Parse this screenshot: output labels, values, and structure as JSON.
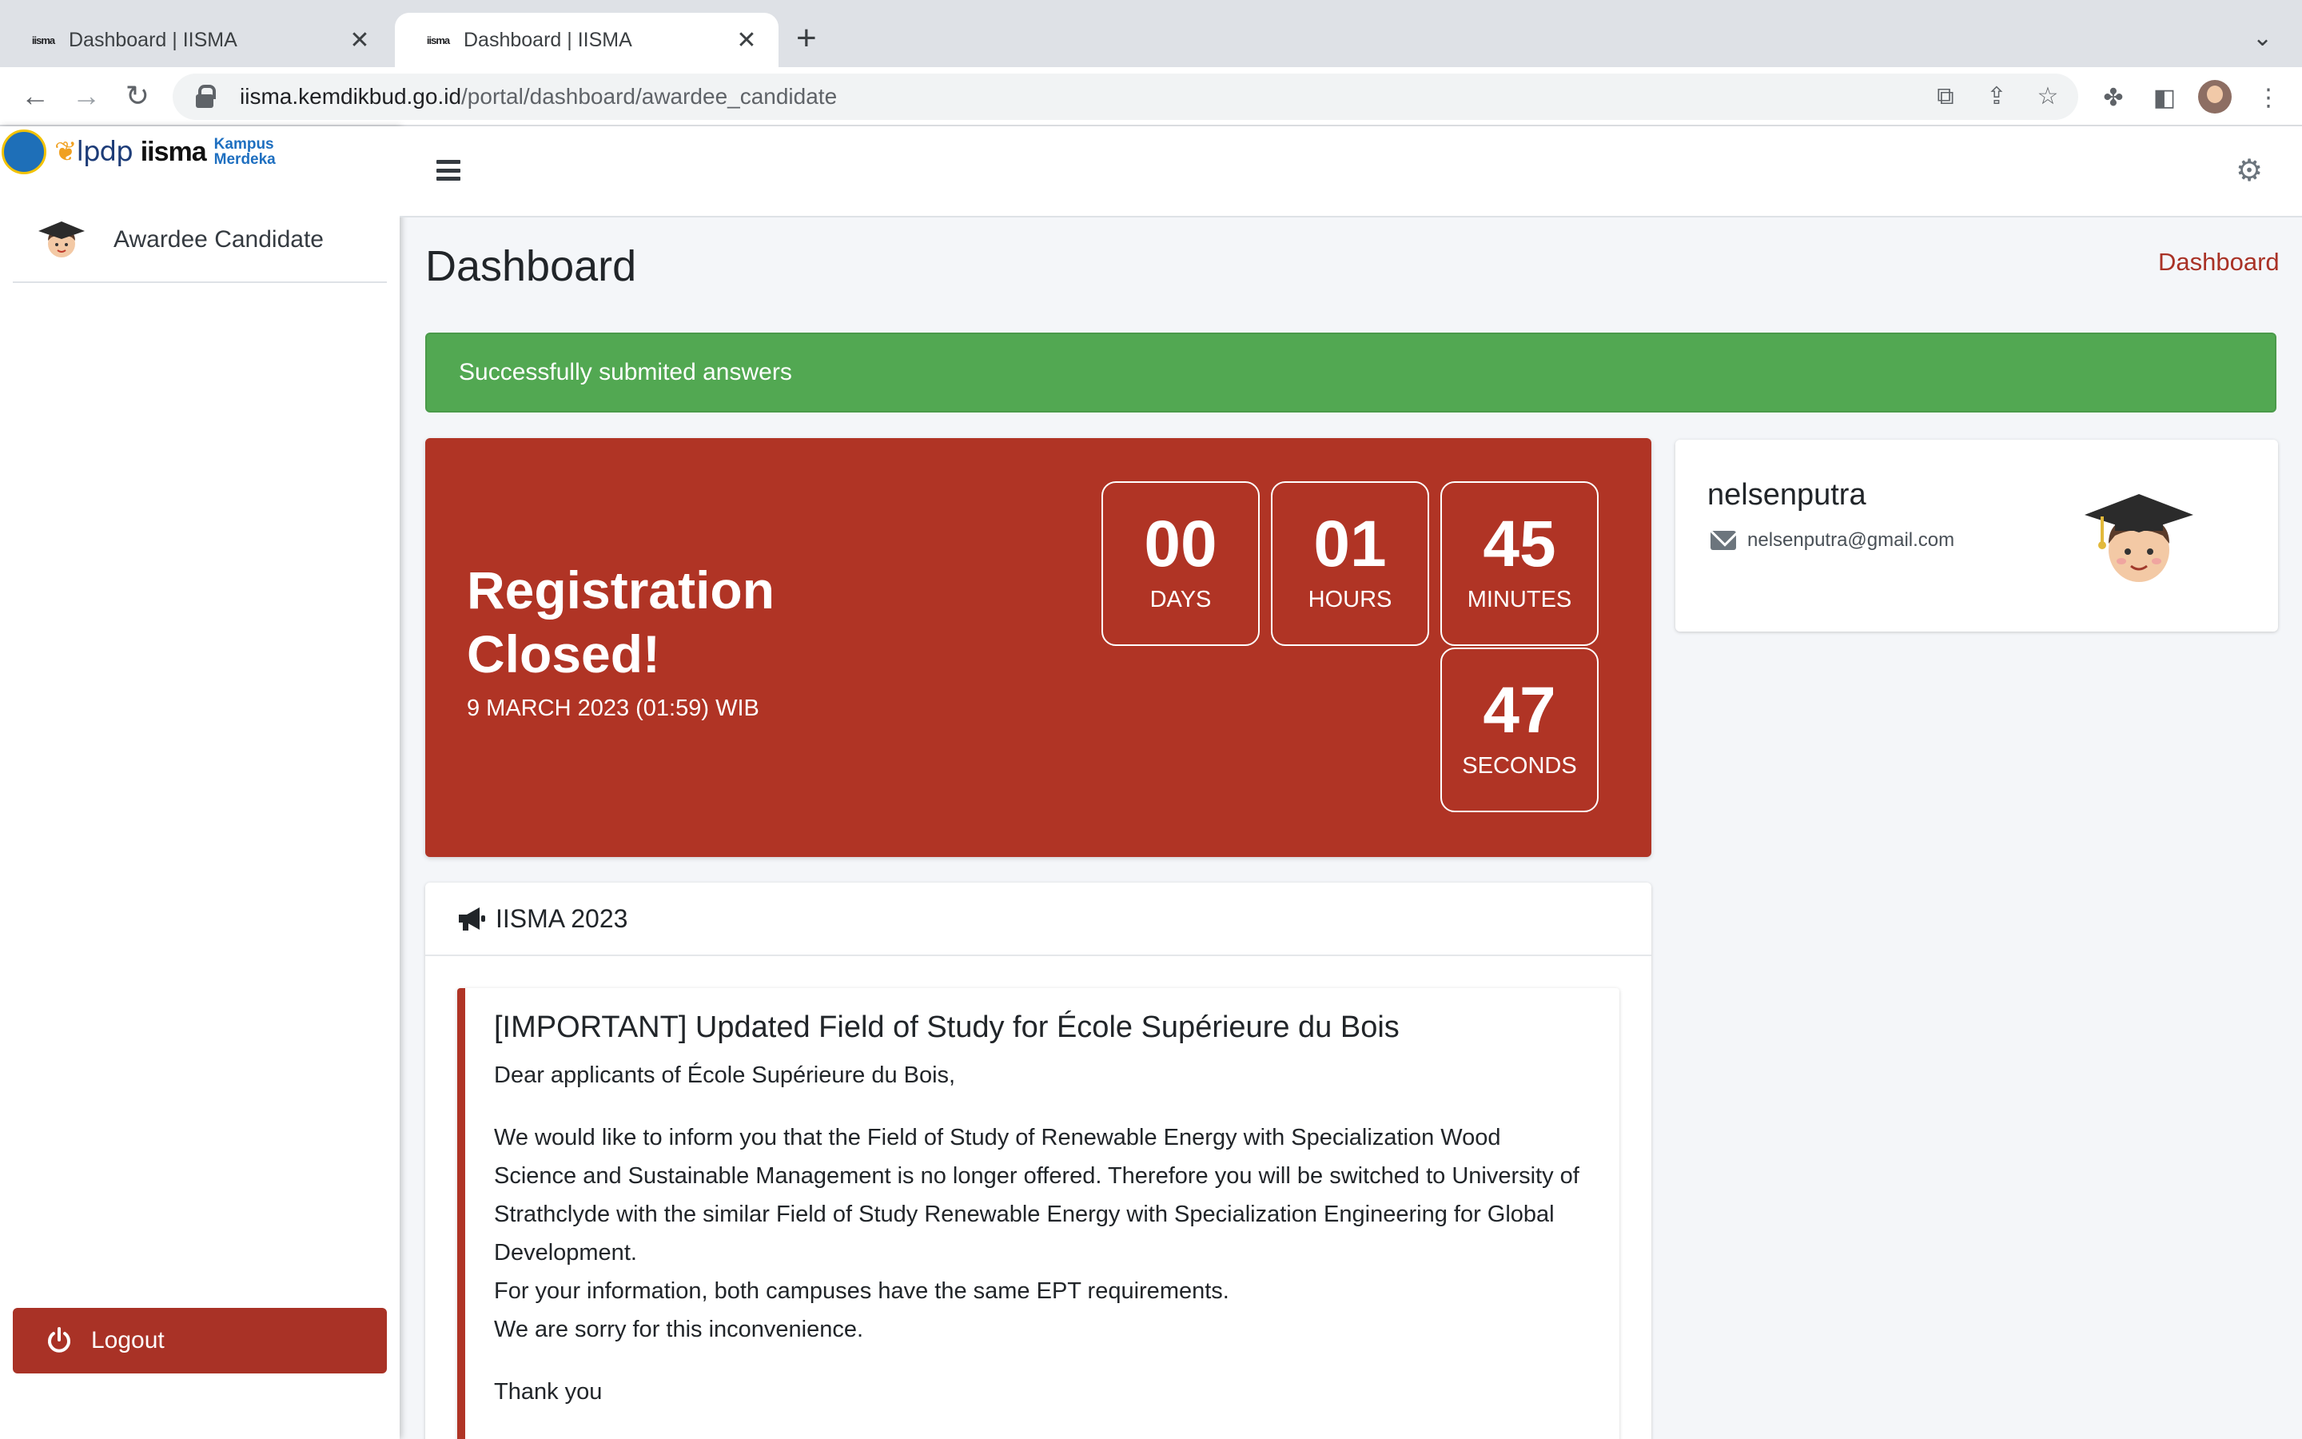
{
  "browser": {
    "tabs": [
      {
        "title": "Dashboard | IISMA",
        "favicon": "iisma"
      },
      {
        "title": "Dashboard | IISMA",
        "favicon": "iisma"
      }
    ],
    "url_host": "iisma.kemdikbud.go.id",
    "url_path": "/portal/dashboard/awardee_candidate"
  },
  "sidebar": {
    "logos": [
      "lpdp",
      "iisma",
      "Kampus",
      "Merdeka"
    ],
    "user_role": "Awardee Candidate",
    "logout_label": "Logout"
  },
  "page": {
    "title": "Dashboard",
    "breadcrumb": "Dashboard"
  },
  "alert": {
    "message": "Successfully submited answers",
    "color": "#52a852"
  },
  "countdown": {
    "title": "Registration Closed!",
    "date": "9 MARCH 2023 (01:59) WIB",
    "days": "00",
    "days_label": "DAYS",
    "hours": "01",
    "hours_label": "HOURS",
    "minutes": "45",
    "minutes_label": "MINUTES",
    "seconds": "47",
    "seconds_label": "SECONDS",
    "color": "#b03425"
  },
  "profile": {
    "username": "nelsenputra",
    "email": "nelsenputra@gmail.com"
  },
  "announcement": {
    "header": "IISMA 2023",
    "title": "[IMPORTANT] Updated Field of Study for École Supérieure du Bois",
    "greeting": "Dear applicants of École Supérieure du Bois,",
    "body": "We would like to inform you that the Field of Study of Renewable Energy with Specialization Wood Science and Sustainable Management is no longer offered. Therefore you will be switched to University of Strathclyde with the similar Field of Study Renewable Energy with Specialization Engineering for Global Development.",
    "line2": "For your information, both campuses have the same EPT requirements.",
    "line3": "We are sorry for this inconvenience.",
    "closing": "Thank you"
  }
}
